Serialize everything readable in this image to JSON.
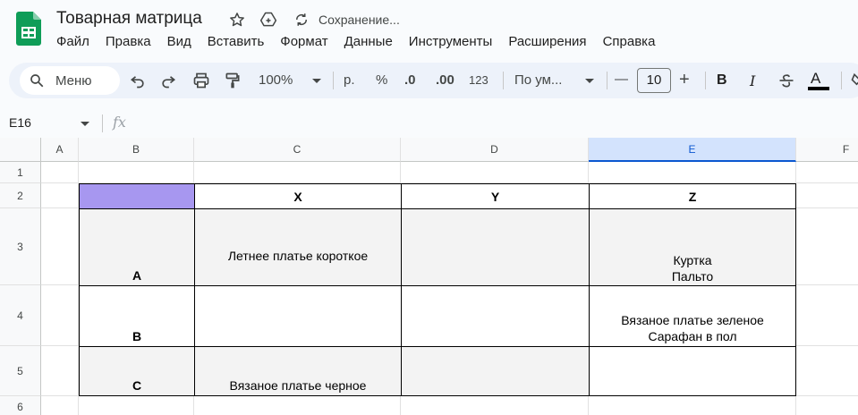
{
  "doc": {
    "title": "Товарная матрица",
    "save_status": "Сохранение...",
    "star_icon": "star-icon",
    "move_icon": "move-to-drive-icon",
    "sync_icon": "saving-sync-icon"
  },
  "menu": [
    "Файл",
    "Правка",
    "Вид",
    "Вставить",
    "Формат",
    "Данные",
    "Инструменты",
    "Расширения",
    "Справка"
  ],
  "toolbar": {
    "search_label": "Меню",
    "zoom": "100%",
    "currency": "р.",
    "percent": "%",
    "dec_decrease": ".0",
    "dec_increase": ".00",
    "number_format": "123",
    "font": "По ум...",
    "font_size": "10",
    "minus": "—",
    "plus": "+",
    "bold": "B",
    "italic": "I",
    "text_color": "A"
  },
  "formula_bar": {
    "cell_ref": "E16",
    "fx": "fx"
  },
  "grid": {
    "columns": [
      "A",
      "B",
      "C",
      "D",
      "E",
      "F"
    ],
    "selected_column": "E",
    "rows": [
      "1",
      "2",
      "3",
      "4",
      "5",
      "6"
    ],
    "header_row": {
      "x": "X",
      "y": "Y",
      "z": "Z"
    },
    "row_labels": {
      "a": "A",
      "b": "B",
      "c": "C"
    },
    "cells": {
      "c3": "Летнее платье короткое",
      "e3": "Куртка\nПальто",
      "e4": "Вязаное платье зеленое\nСарафан в пол",
      "c5": "Вязаное платье черное"
    },
    "colors": {
      "purple_fill": "#a797f0",
      "shaded_fill": "#f3f3f3",
      "selected_header": "#d3e3fd"
    }
  }
}
